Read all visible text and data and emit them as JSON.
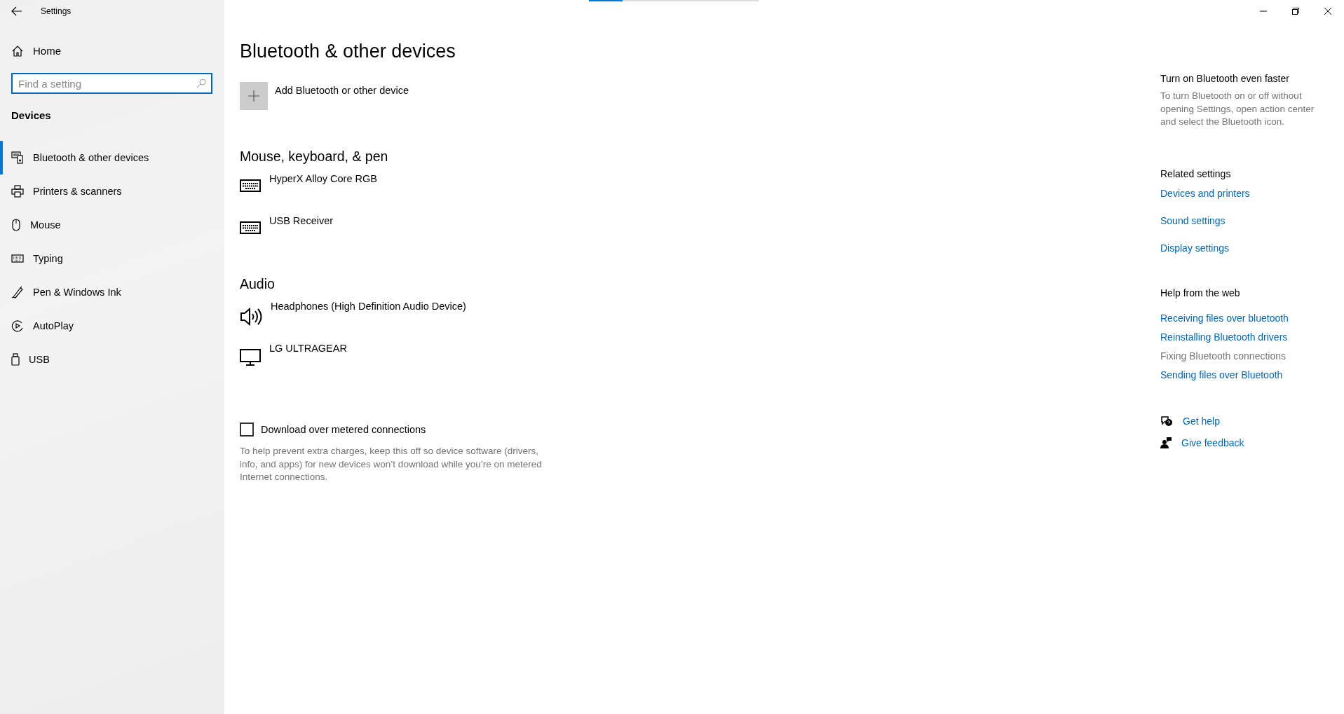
{
  "window": {
    "title": "Settings",
    "controls": [
      {
        "kind": "minimize"
      },
      {
        "kind": "restore"
      },
      {
        "kind": "close"
      }
    ]
  },
  "loading_bar": {
    "level": 0.2
  },
  "sidebar": {
    "home": "Home",
    "search": {
      "placeholder": "Find a setting"
    },
    "section": "Devices",
    "items": [
      {
        "label": "Bluetooth & other devices",
        "kind": "devices",
        "selected": true
      },
      {
        "label": "Printers & scanners",
        "kind": "printer",
        "selected": false
      },
      {
        "label": "Mouse",
        "kind": "mouse",
        "selected": false
      },
      {
        "label": "Typing",
        "kind": "keyboard",
        "selected": false
      },
      {
        "label": "Pen & Windows Ink",
        "kind": "pen",
        "selected": false
      },
      {
        "label": "AutoPlay",
        "kind": "autoplay",
        "selected": false
      },
      {
        "label": "USB",
        "kind": "usb",
        "selected": false
      }
    ]
  },
  "main": {
    "title": "Bluetooth & other devices",
    "add_device": "Add Bluetooth or other device",
    "groups": [
      {
        "title": "Mouse, keyboard, & pen",
        "devices": [
          {
            "name": "HyperX Alloy Core RGB",
            "kind": "keyboard"
          },
          {
            "name": "USB Receiver",
            "kind": "keyboard"
          }
        ]
      },
      {
        "title": "Audio",
        "devices": [
          {
            "name": "Headphones (High Definition Audio Device)",
            "kind": "speaker"
          },
          {
            "name": "LG ULTRAGEAR",
            "kind": "monitor"
          }
        ]
      }
    ],
    "metered": {
      "label": "Download over metered connections",
      "checked": false,
      "description": "To help prevent extra charges, keep this off so device software (drivers, info, and apps) for new devices won’t download while you’re on metered Internet connections."
    }
  },
  "aside": {
    "tip": {
      "title": "Turn on Bluetooth even faster",
      "text": "To turn Bluetooth on or off without opening Settings, open action center and select the Bluetooth icon."
    },
    "related": {
      "title": "Related settings",
      "links": [
        {
          "label": "Devices and printers",
          "disabled": false
        },
        {
          "label": "Sound settings",
          "disabled": false
        },
        {
          "label": "Display settings",
          "disabled": false
        }
      ]
    },
    "help": {
      "title": "Help from the web",
      "links": [
        {
          "label": "Receiving files over bluetooth",
          "disabled": false
        },
        {
          "label": "Reinstalling Bluetooth drivers",
          "disabled": false
        },
        {
          "label": "Fixing Bluetooth connections",
          "disabled": true
        },
        {
          "label": "Sending files over Bluetooth",
          "disabled": false
        }
      ]
    },
    "actions": [
      {
        "label": "Get help",
        "kind": "help"
      },
      {
        "label": "Give feedback",
        "kind": "feedback"
      }
    ]
  }
}
